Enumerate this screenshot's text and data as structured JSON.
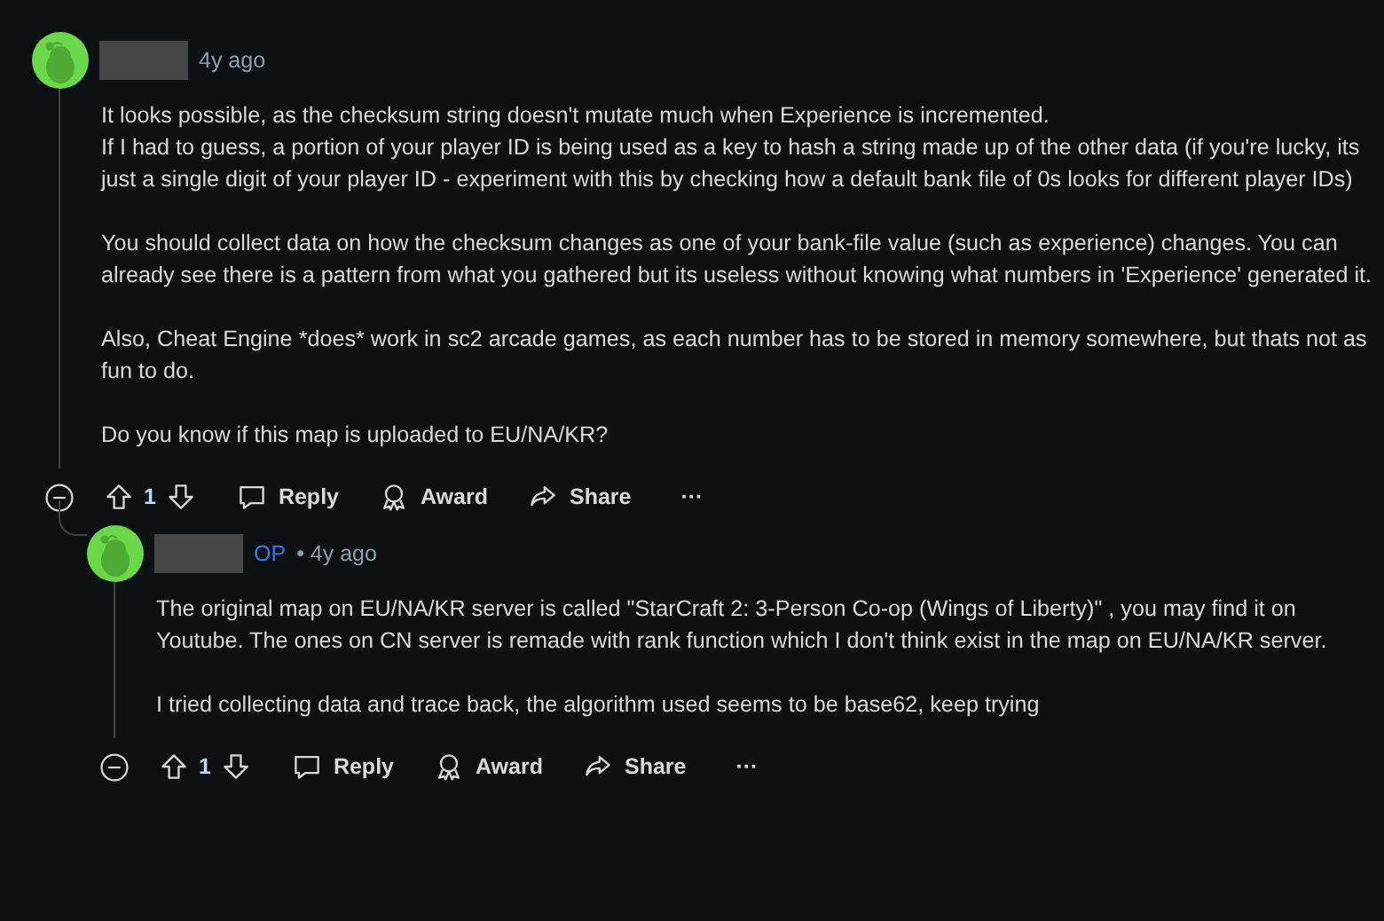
{
  "comments": [
    {
      "age": "4y ago",
      "paragraphs": [
        "It looks possible, as the checksum string doesn't mutate much when Experience is incremented.\nIf I had to guess, a portion of your player ID is being used as a key to hash a string made up of the other data (if you're lucky, its just a single digit of your player ID - experiment with this by checking how a default bank file of 0s looks for different player IDs)",
        "You should collect data on how the checksum changes as one of your bank-file value (such as experience) changes. You can already see there is a pattern from what you gathered but its useless without knowing what numbers in 'Experience' generated it.",
        "Also, Cheat Engine *does* work in sc2 arcade games, as each number has to be stored in memory somewhere, but thats not as fun to do.",
        "Do you know if this map is uploaded to EU/NA/KR?"
      ],
      "votes": "1",
      "actions": [
        "Reply",
        "Award",
        "Share",
        "···"
      ],
      "children": [
        {
          "op_label": "OP",
          "age": "• 4y ago",
          "paragraphs": [
            "The original map on EU/NA/KR server is called \"StarCraft 2: 3-Person Co-op (Wings of Liberty)\" , you may find it on Youtube. The ones on CN server is remade with rank function which I don't think exist in the map on EU/NA/KR server.",
            "I tried collecting data and trace back, the algorithm used seems to be base62, keep trying"
          ],
          "votes": "1",
          "actions": [
            "Reply",
            "Award",
            "Share",
            "···"
          ]
        }
      ]
    }
  ]
}
